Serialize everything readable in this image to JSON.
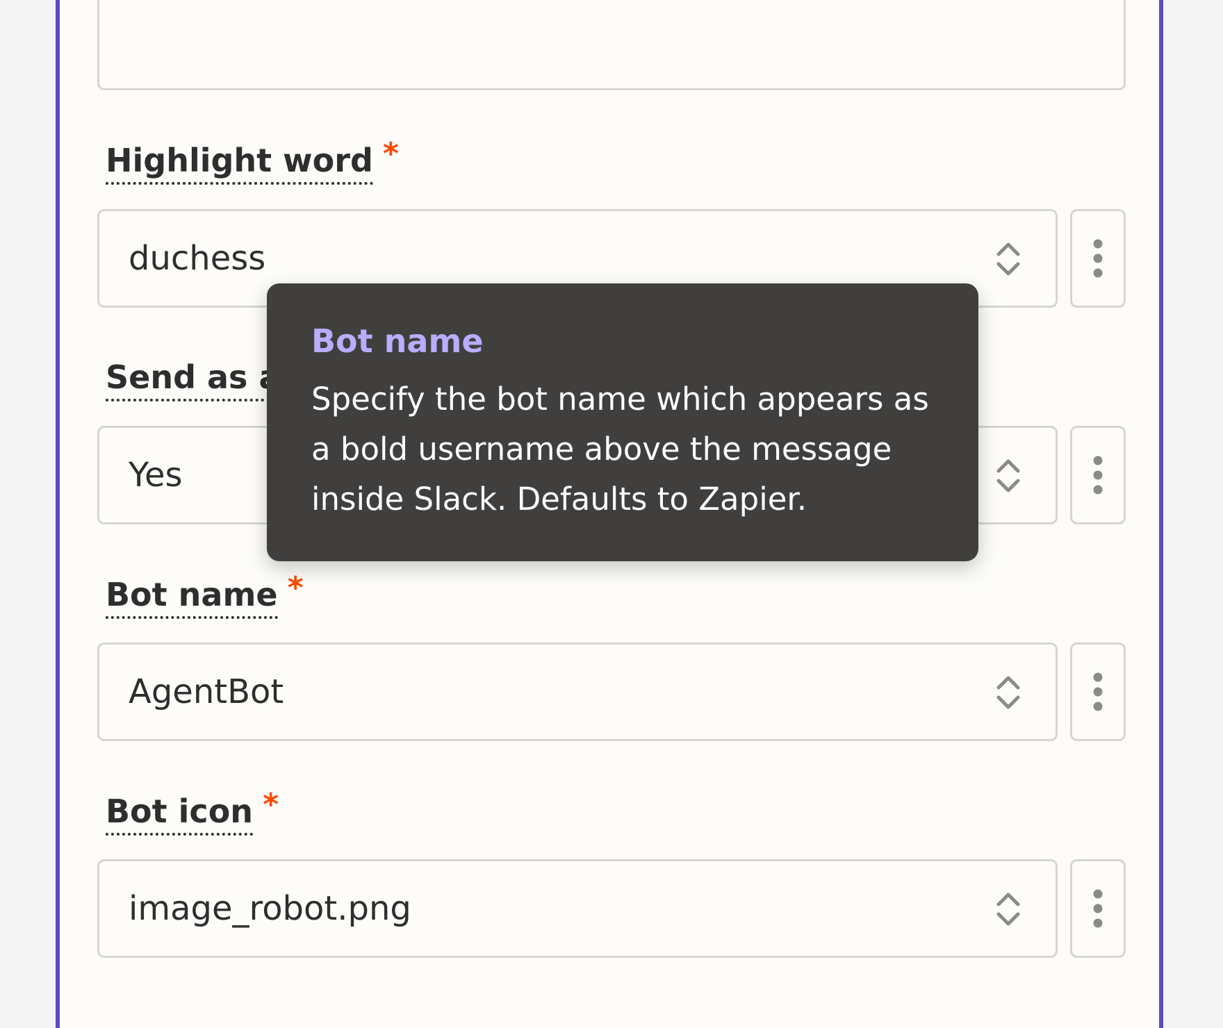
{
  "fields": [
    {
      "label": "Highlight word",
      "value": "duchess",
      "required": "*"
    },
    {
      "label": "Send as a",
      "value": "Yes",
      "required": ""
    },
    {
      "label": "Bot name",
      "value": "AgentBot",
      "required": "*"
    },
    {
      "label": "Bot icon",
      "value": "image_robot.png",
      "required": "*"
    }
  ],
  "tooltip": {
    "title": "Bot name",
    "body": "Specify the bot name which appears as a bold username above the message inside Slack. Defaults to Zapier."
  },
  "icons": {
    "select": "chevron-up-down-icon",
    "more": "more-vertical-icon"
  },
  "colors": {
    "accent_border": "#5b4cc4",
    "required": "#ff4a00",
    "tooltip_bg": "#403f3e",
    "tooltip_title": "#b8adff"
  }
}
